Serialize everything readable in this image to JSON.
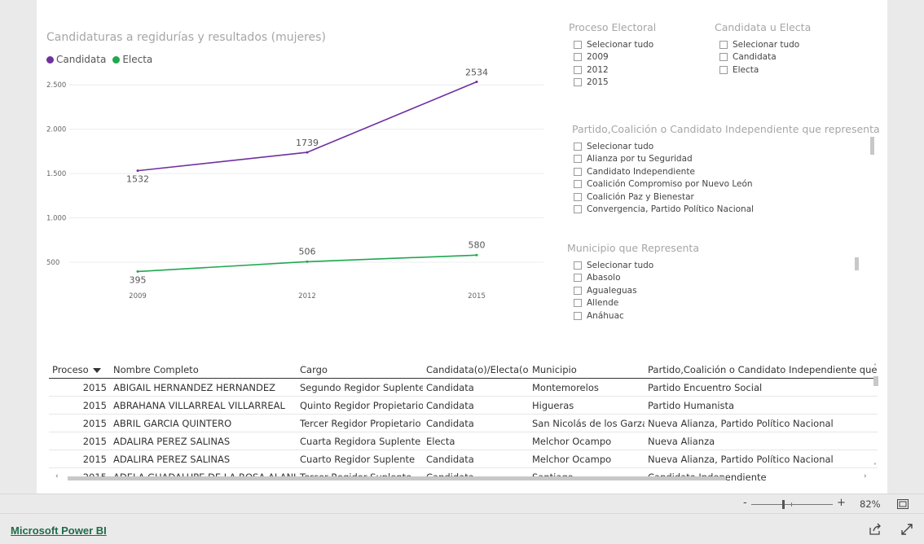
{
  "chart": {
    "title": "Candidaturas a regidurías y resultados (mujeres)",
    "legend": [
      {
        "name": "Candidata",
        "color": "#7030a0"
      },
      {
        "name": "Electa",
        "color": "#1fa84f"
      }
    ]
  },
  "chart_data": {
    "type": "line",
    "x": [
      "2009",
      "2012",
      "2015"
    ],
    "series": [
      {
        "name": "Candidata",
        "values": [
          1532,
          1739,
          2534
        ],
        "color": "#7030a0"
      },
      {
        "name": "Electa",
        "values": [
          395,
          506,
          580
        ],
        "color": "#1fa84f"
      }
    ],
    "yticks": [
      "500",
      "1.000",
      "1.500",
      "2.000",
      "2.500"
    ],
    "data_labels": [
      [
        "1532",
        "1739",
        "2534"
      ],
      [
        "395",
        "506",
        "580"
      ]
    ],
    "ylim": [
      250,
      2600
    ],
    "grid": true,
    "legend": "top-left",
    "title": "Candidaturas a regidurías y resultados (mujeres)"
  },
  "slicers": {
    "proceso": {
      "title": "Proceso Electoral",
      "items": [
        "Selecionar tudo",
        "2009",
        "2012",
        "2015"
      ]
    },
    "candidata": {
      "title": "Candidata u Electa",
      "items": [
        "Selecionar tudo",
        "Candidata",
        "Electa"
      ]
    },
    "partido": {
      "title": "Partido,Coalición o Candidato Independiente que representa",
      "items": [
        "Selecionar tudo",
        "Alianza por tu Seguridad",
        "Candidato Independiente",
        "Coalición Compromiso por Nuevo León",
        "Coalición Paz y Bienestar",
        "Convergencia, Partido Político Nacional"
      ]
    },
    "municipio": {
      "title": "Municipio que Representa",
      "items": [
        "Selecionar tudo",
        "Abasolo",
        "Agualeguas",
        "Allende",
        "Anáhuac"
      ]
    }
  },
  "table": {
    "columns": [
      "Proceso",
      "Nombre Completo",
      "Cargo",
      "Candidata(o)/Electa(o)",
      "Municipio",
      "Partido,Coalición o Candidato Independiente que representa"
    ],
    "rows": [
      [
        "2015",
        "ABIGAIL HERNANDEZ HERNANDEZ",
        "Segundo Regidor Suplente",
        "Candidata",
        "Montemorelos",
        "Partido Encuentro Social"
      ],
      [
        "2015",
        "ABRAHANA VILLARREAL VILLARREAL",
        "Quinto Regidor Propietario",
        "Candidata",
        "Higueras",
        "Partido Humanista"
      ],
      [
        "2015",
        "ABRIL GARCIA QUINTERO",
        "Tercer Regidor Propietario",
        "Candidata",
        "San Nicolás de los Garza",
        "Nueva Alianza, Partido Político Nacional"
      ],
      [
        "2015",
        "ADALIRA PEREZ SALINAS",
        "Cuarta Regidora Suplente",
        "Electa",
        "Melchor Ocampo",
        "Nueva Alianza"
      ],
      [
        "2015",
        "ADALIRA PEREZ SALINAS",
        "Cuarto Regidor Suplente",
        "Candidata",
        "Melchor Ocampo",
        "Nueva Alianza, Partido Político Nacional"
      ],
      [
        "2015",
        "ADELA GUADALUPE DE LA ROSA ALANIS",
        "Tercer Regidor Suplente",
        "Candidata",
        "Santiago",
        "Candidato Independiente"
      ]
    ]
  },
  "zoom": {
    "minus": "-",
    "plus": "+",
    "level": "82%"
  },
  "footer": {
    "link": "Microsoft Power BI"
  },
  "icons": {
    "fit": "fit-page-icon",
    "share": "share-icon",
    "fullscreen": "fullscreen-icon"
  }
}
